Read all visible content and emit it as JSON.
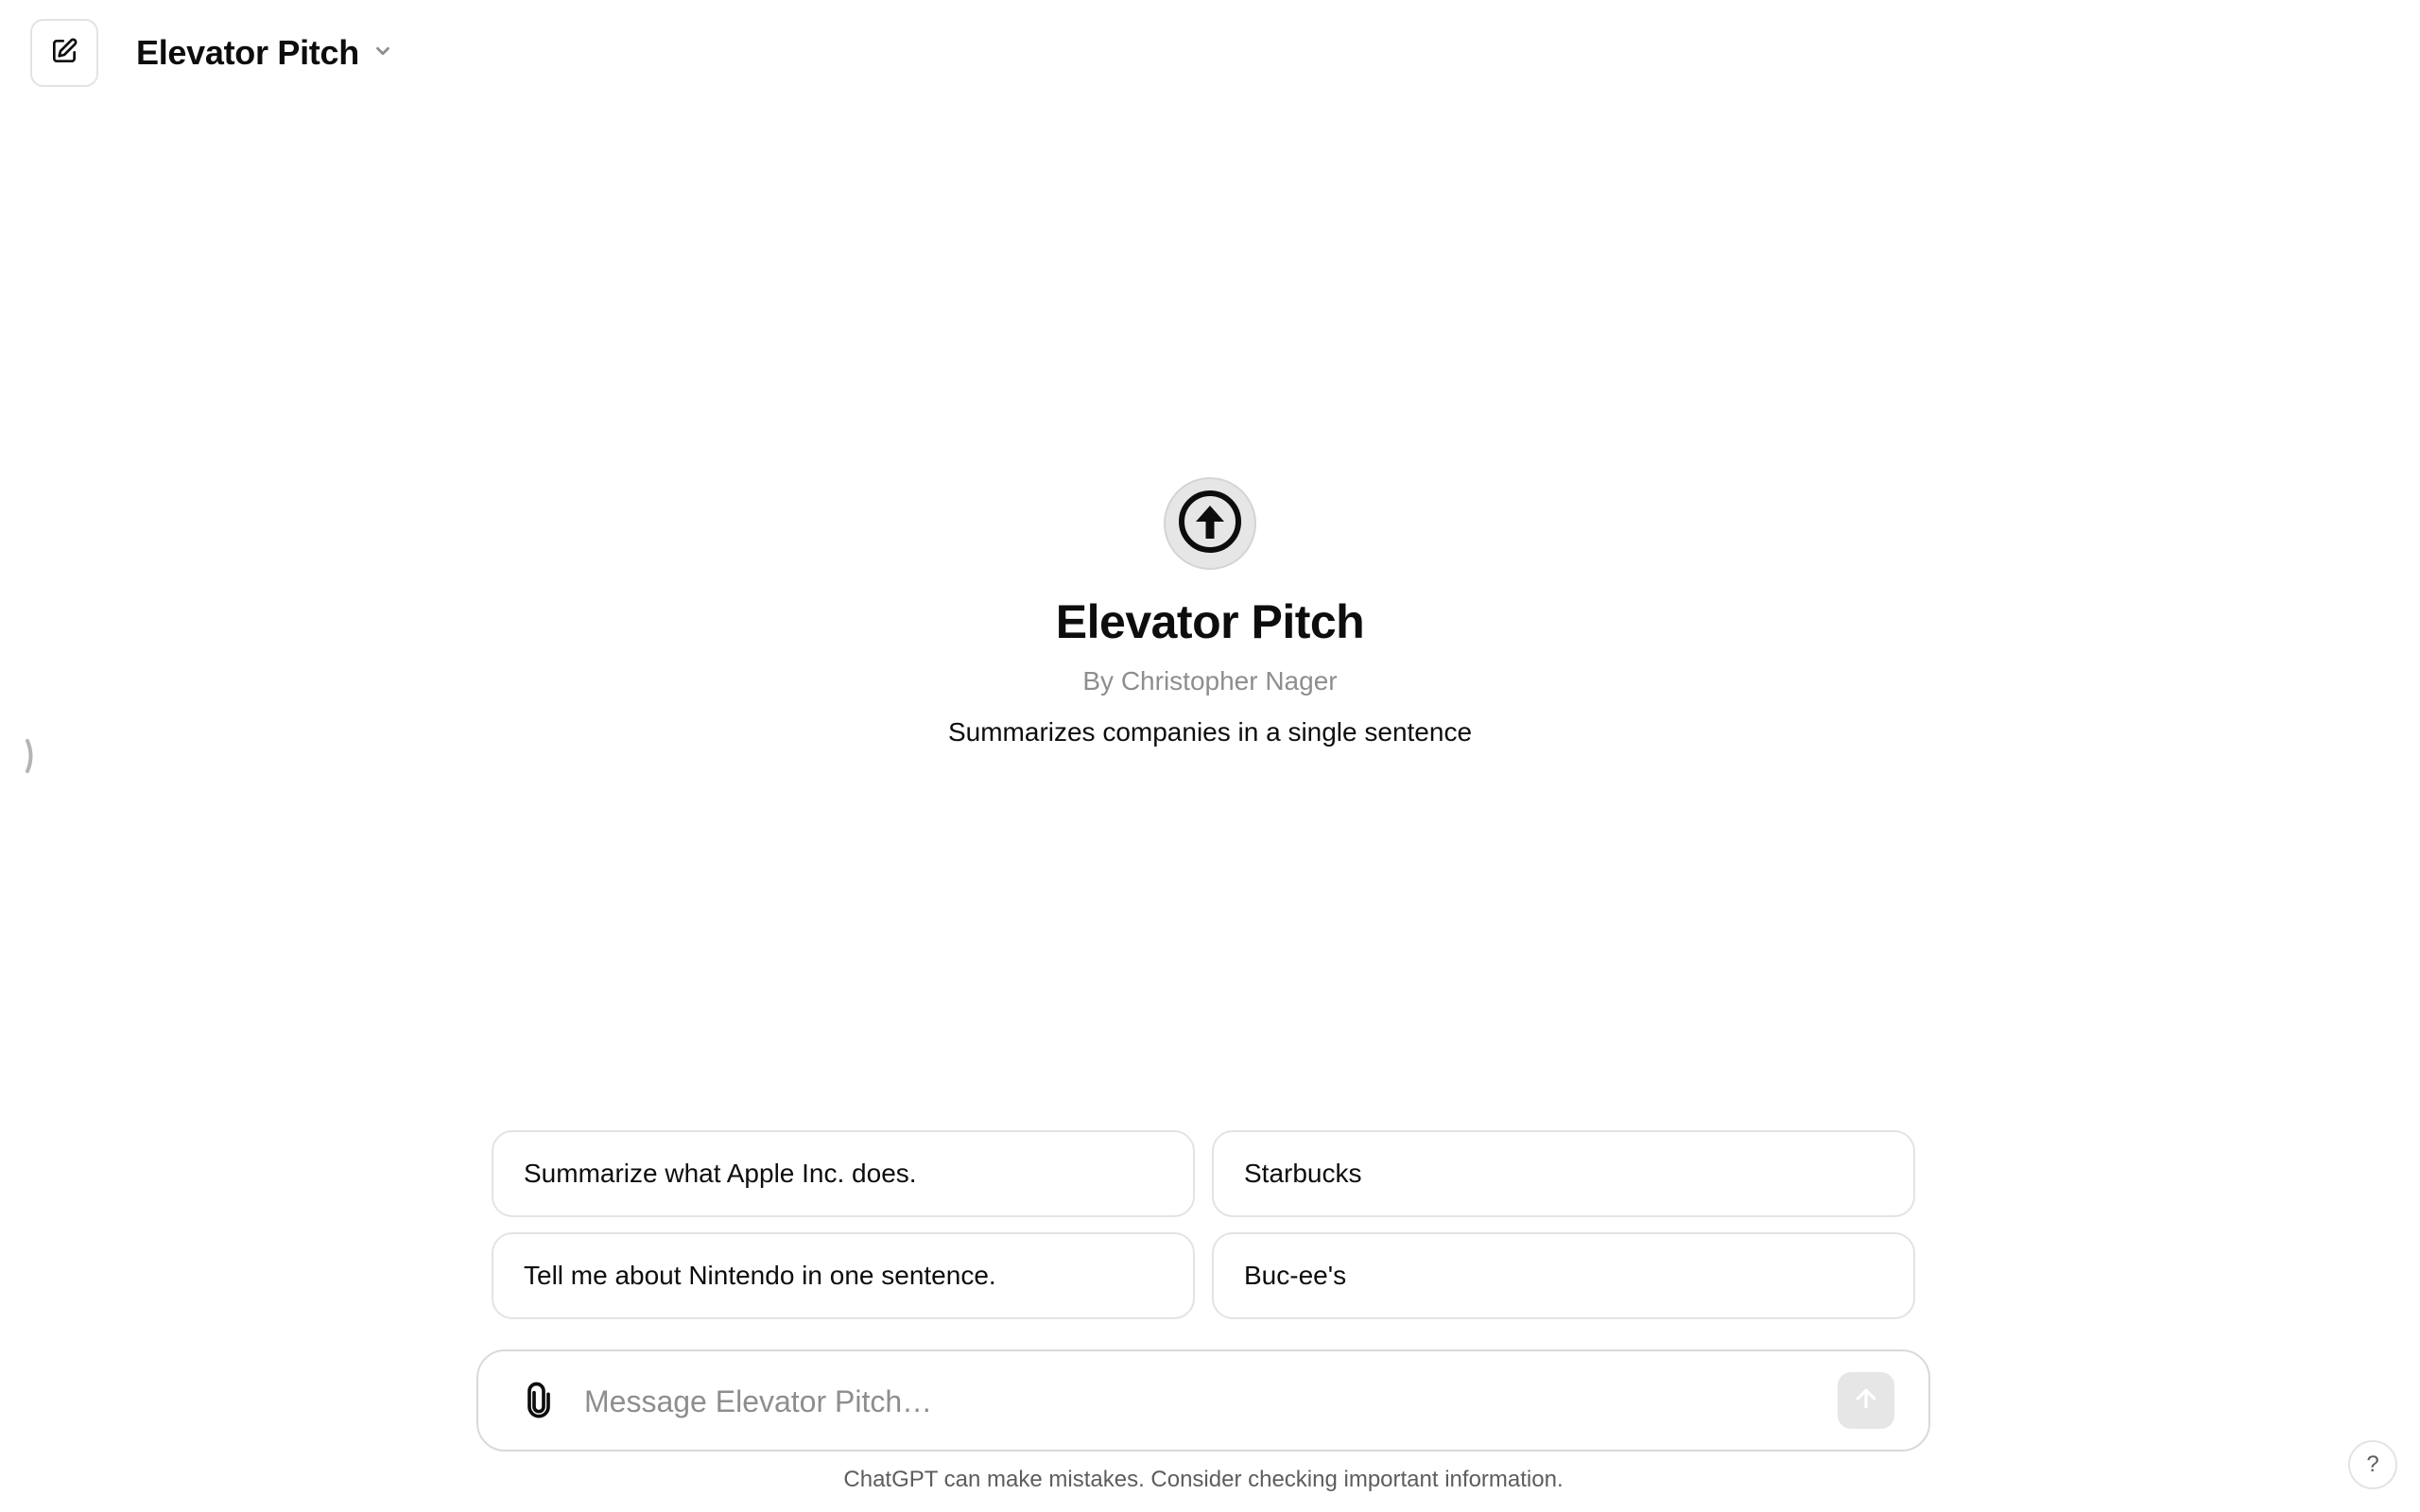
{
  "header": {
    "new_chat_icon": "edit-icon",
    "model_title": "Elevator Pitch",
    "dropdown_icon": "chevron-down-icon"
  },
  "sidebar": {
    "toggle_icon": "chevron-right-icon"
  },
  "gpt": {
    "avatar_icon": "circled-arrow-up-icon",
    "title": "Elevator Pitch",
    "author": "By Christopher Nager",
    "description": "Summarizes companies in a single sentence"
  },
  "starters": [
    "Summarize what Apple Inc. does.",
    "Starbucks",
    "Tell me about Nintendo in one sentence.",
    "Buc-ee's"
  ],
  "composer": {
    "attach_icon": "paperclip-icon",
    "placeholder": "Message Elevator Pitch…",
    "value": "",
    "send_icon": "arrow-up-icon"
  },
  "footer": {
    "disclaimer": "ChatGPT can make mistakes. Consider checking important information.",
    "help_label": "?"
  },
  "colors": {
    "text": "#0d0d0d",
    "muted": "#8e8e8e",
    "border": "#e3e3e3",
    "send_disabled": "#e6e6e6"
  }
}
